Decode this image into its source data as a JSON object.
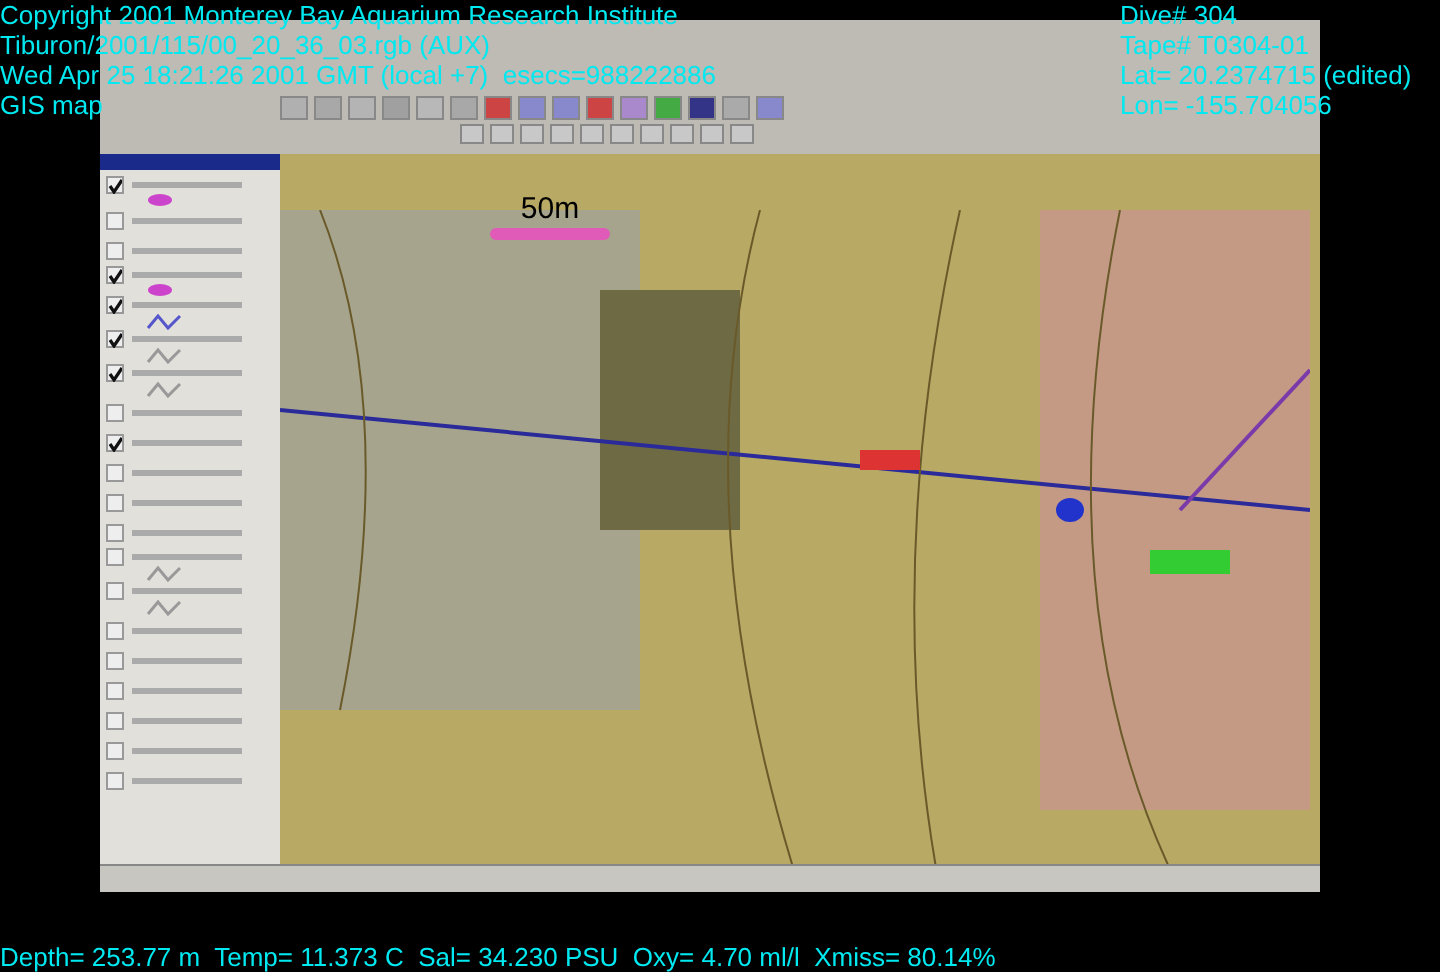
{
  "overlay": {
    "lines_left": [
      "Copyright 2001 Monterey Bay Aquarium Research Institute",
      "Tiburon/2001/115/00_20_36_03.rgb (AUX)",
      "Wed Apr 25 18:21:26 2001 GMT (local +7)  esecs=988222886",
      "GIS map"
    ],
    "lines_right": [
      "Dive# 304",
      "Tape# T0304-01",
      "Lat= 20.2374715 (edited)",
      "Lon= -155.704056"
    ],
    "bottom": "Depth= 253.77 m  Temp= 11.373 C  Sal= 34.230 PSU  Oxy= 4.70 ml/l  Xmiss= 80.14%"
  },
  "layers": [
    {
      "kind": "dot",
      "checked": true,
      "color": "#cc44cc"
    },
    {
      "kind": "plain",
      "checked": false
    },
    {
      "kind": "plain",
      "checked": false
    },
    {
      "kind": "dot",
      "checked": true,
      "color": "#cc44cc"
    },
    {
      "kind": "line",
      "checked": true,
      "color": "#5555cc"
    },
    {
      "kind": "line",
      "checked": true,
      "color": "#999999"
    },
    {
      "kind": "line",
      "checked": true,
      "color": "#999999"
    },
    {
      "kind": "plain",
      "checked": false
    },
    {
      "kind": "plain",
      "checked": true
    },
    {
      "kind": "plain",
      "checked": false
    },
    {
      "kind": "plain",
      "checked": false
    },
    {
      "kind": "plain",
      "checked": false
    },
    {
      "kind": "line",
      "checked": false,
      "color": "#999999"
    },
    {
      "kind": "line",
      "checked": false,
      "color": "#999999"
    },
    {
      "kind": "plain",
      "checked": false
    },
    {
      "kind": "plain",
      "checked": false
    },
    {
      "kind": "plain",
      "checked": false
    },
    {
      "kind": "plain",
      "checked": false
    },
    {
      "kind": "plain",
      "checked": false
    },
    {
      "kind": "plain",
      "checked": false
    }
  ],
  "map": {
    "scale_label": "50m"
  }
}
